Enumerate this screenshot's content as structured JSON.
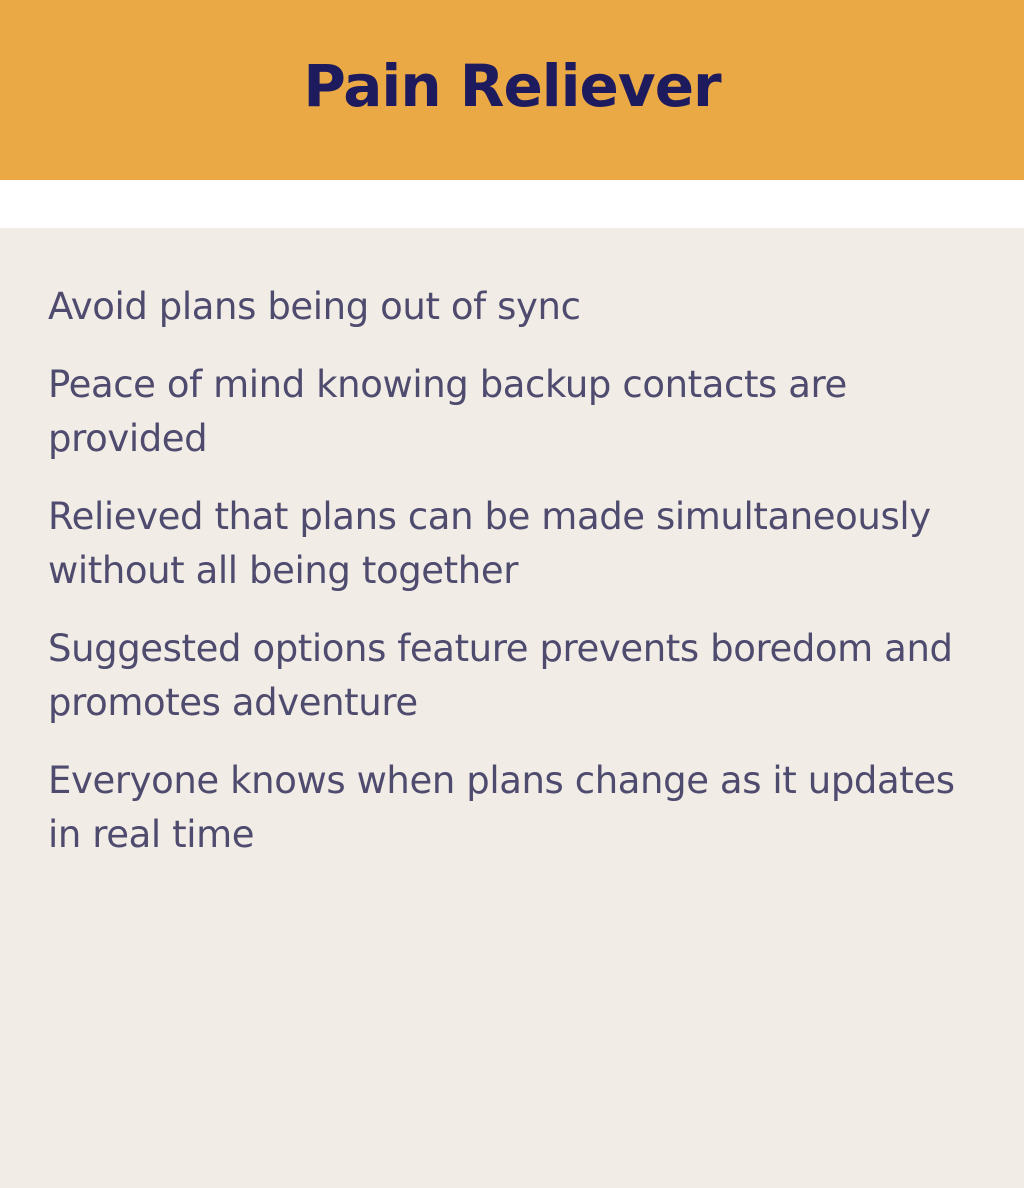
{
  "header": {
    "title": "Pain Reliever"
  },
  "list": {
    "items": [
      {
        "text": "Avoid plans being out of sync"
      },
      {
        "text": "Peace of mind knowing backup contacts are provided"
      },
      {
        "text": "Relieved that plans can be made simultaneously without all being together"
      },
      {
        "text": "Suggested options feature prevents boredom and promotes adventure"
      },
      {
        "text": "Everyone knows when plans change as it updates in real time"
      }
    ]
  },
  "colors": {
    "header_background": "#eaa944",
    "title_text": "#1d1a5e",
    "panel_background": "#f1ece5",
    "body_text": "#4f4b6f"
  }
}
